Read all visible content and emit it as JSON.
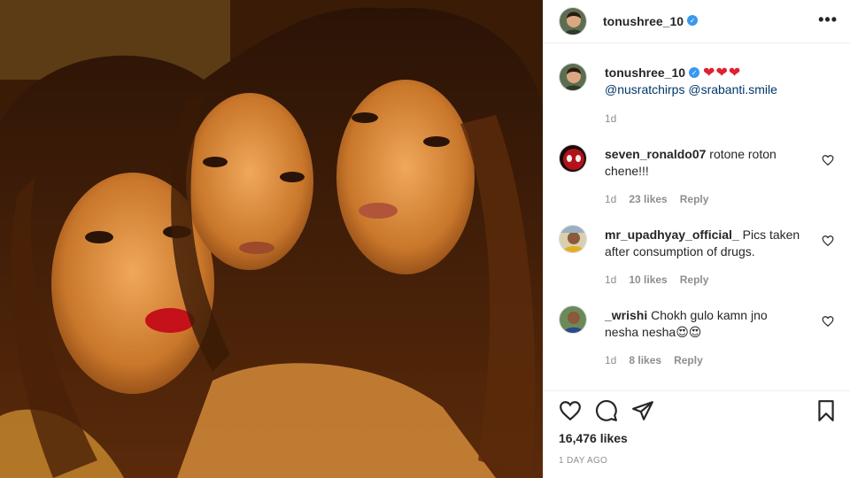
{
  "post": {
    "author": "tonushree_10",
    "verified": "✓",
    "more_icon": "more-options-icon"
  },
  "caption": {
    "username": "tonushree_10",
    "hearts": "❤❤❤",
    "mention_1": "@nusratchirps",
    "mention_2": "@srabanti.smile",
    "age": "1d"
  },
  "comments": [
    {
      "username": "seven_ronaldo07",
      "text": "rotone roton chene!!!",
      "age": "1d",
      "likes": "23 likes",
      "reply": "Reply"
    },
    {
      "username": "mr_upadhyay_official_",
      "text": "Pics taken after consumption of drugs.",
      "age": "1d",
      "likes": "10 likes",
      "reply": "Reply"
    },
    {
      "username": "_wrishi",
      "text": "Chokh gulo kamn jno nesha nesha",
      "emoji": "😍😍",
      "age": "1d",
      "likes": "8 likes",
      "reply": "Reply"
    }
  ],
  "footer": {
    "like_count": "16,476 likes",
    "timestamp": "1 DAY AGO"
  },
  "colors": {
    "verified": "#3897f0",
    "mention": "#00376b",
    "meta": "#8e8e8e",
    "heart": "#e0202f"
  }
}
